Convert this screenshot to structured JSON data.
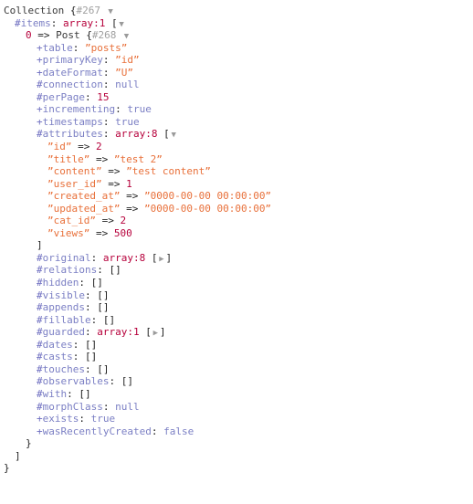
{
  "dump": {
    "root_class": "Collection",
    "root_id": "#267",
    "root_open_brace": "{",
    "root_close_brace": "}",
    "toggle_open": "▼",
    "toggle_closed": "▶",
    "arrow": "=>",
    "colon": ":",
    "open_bracket": "[",
    "close_bracket": "]",
    "empty_array": "[]",
    "items": {
      "sigil": "#",
      "name": "items",
      "type": "array:1",
      "close": "]"
    },
    "post": {
      "key": "0",
      "class": "Post",
      "id": "#268",
      "open_brace": "{",
      "close_brace": "}"
    },
    "properties": [
      {
        "sigil": "+",
        "name": "table",
        "value": "”posts”",
        "kind": "str"
      },
      {
        "sigil": "+",
        "name": "primaryKey",
        "value": "”id”",
        "kind": "str"
      },
      {
        "sigil": "+",
        "name": "dateFormat",
        "value": "”U”",
        "kind": "str"
      },
      {
        "sigil": "#",
        "name": "connection",
        "value": "null",
        "kind": "kw"
      },
      {
        "sigil": "#",
        "name": "perPage",
        "value": "15",
        "kind": "num"
      },
      {
        "sigil": "+",
        "name": "incrementing",
        "value": "true",
        "kind": "kw"
      },
      {
        "sigil": "+",
        "name": "timestamps",
        "value": "true",
        "kind": "kw"
      }
    ],
    "attributes": {
      "sigil": "#",
      "name": "attributes",
      "type": "array:8",
      "entries": [
        {
          "key": "”id”",
          "value": "2",
          "kind": "num"
        },
        {
          "key": "”title”",
          "value": "”test 2”",
          "kind": "str"
        },
        {
          "key": "”content”",
          "value": "”test content”",
          "kind": "str"
        },
        {
          "key": "”user_id”",
          "value": "1",
          "kind": "num"
        },
        {
          "key": "”created_at”",
          "value": "”0000-00-00 00:00:00”",
          "kind": "str"
        },
        {
          "key": "”updated_at”",
          "value": "”0000-00-00 00:00:00”",
          "kind": "str"
        },
        {
          "key": "”cat_id”",
          "value": "2",
          "kind": "num"
        },
        {
          "key": "”views”",
          "value": "500",
          "kind": "num"
        }
      ]
    },
    "properties_tail": [
      {
        "sigil": "#",
        "name": "original",
        "value": "array:8",
        "kind": "collapsed"
      },
      {
        "sigil": "#",
        "name": "relations",
        "value": "[]",
        "kind": "empty"
      },
      {
        "sigil": "#",
        "name": "hidden",
        "value": "[]",
        "kind": "empty"
      },
      {
        "sigil": "#",
        "name": "visible",
        "value": "[]",
        "kind": "empty"
      },
      {
        "sigil": "#",
        "name": "appends",
        "value": "[]",
        "kind": "empty"
      },
      {
        "sigil": "#",
        "name": "fillable",
        "value": "[]",
        "kind": "empty"
      },
      {
        "sigil": "#",
        "name": "guarded",
        "value": "array:1",
        "kind": "collapsed"
      },
      {
        "sigil": "#",
        "name": "dates",
        "value": "[]",
        "kind": "empty"
      },
      {
        "sigil": "#",
        "name": "casts",
        "value": "[]",
        "kind": "empty"
      },
      {
        "sigil": "#",
        "name": "touches",
        "value": "[]",
        "kind": "empty"
      },
      {
        "sigil": "#",
        "name": "observables",
        "value": "[]",
        "kind": "empty"
      },
      {
        "sigil": "#",
        "name": "with",
        "value": "[]",
        "kind": "empty"
      },
      {
        "sigil": "#",
        "name": "morphClass",
        "value": "null",
        "kind": "kw"
      },
      {
        "sigil": "+",
        "name": "exists",
        "value": "true",
        "kind": "kw"
      },
      {
        "sigil": "+",
        "name": "wasRecentlyCreated",
        "value": "false",
        "kind": "kw"
      }
    ]
  }
}
